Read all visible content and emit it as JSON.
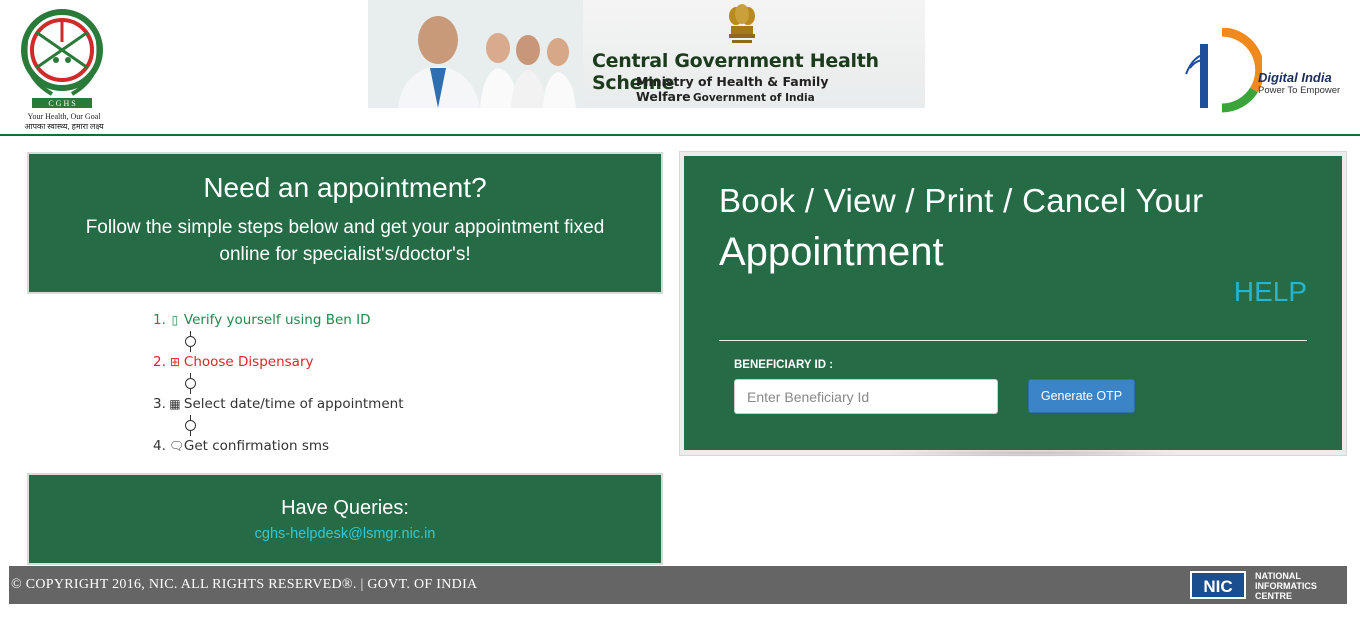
{
  "header": {
    "cghs_caption_line1": "Your Health, Our Goal",
    "cghs_caption_line2": "आपका स्वास्थ्य, हमारा लक्ष्य",
    "banner_title": "Central Government Health Scheme",
    "banner_ministry": "Ministry of Health & Family Welfare",
    "banner_gov": "Government of India",
    "digital_india_title": "Digital India",
    "digital_india_tagline": "Power To Empower"
  },
  "appointment_info": {
    "heading": "Need an appointment?",
    "subtext": "Follow the simple steps below and get your appointment fixed online for specialist's/doctor's!"
  },
  "steps": [
    {
      "num": "1.",
      "icon": "mobile-icon",
      "label": "Verify yourself using Ben ID"
    },
    {
      "num": "2.",
      "icon": "hospital-icon",
      "label": "Choose Dispensary"
    },
    {
      "num": "3.",
      "icon": "calendar-icon",
      "label": "Select date/time of appointment"
    },
    {
      "num": "4.",
      "icon": "comments-icon",
      "label": "Get confirmation sms"
    }
  ],
  "queries": {
    "heading": "Have Queries:",
    "email": "cghs-helpdesk@lsmgr.nic.in"
  },
  "booking": {
    "title_line1": "Book / View / Print / Cancel Your",
    "title_line2": "Appointment",
    "help_link": "HELP",
    "beneficiary_label": "BENEFICIARY ID :",
    "beneficiary_placeholder": "Enter Beneficiary Id",
    "beneficiary_value": "",
    "generate_otp_label": "Generate OTP"
  },
  "footer": {
    "copyright": "© COPYRIGHT 2016, NIC. ALL RIGHTS RESERVED®. | GOVT. OF INDIA",
    "nic_line1": "NATIONAL",
    "nic_line2": "INFORMATICS",
    "nic_line3": "CENTRE"
  },
  "colors": {
    "panel_green": "#256b45",
    "header_rule": "#1d6b2f",
    "help_cyan": "#23b5d3",
    "step_green": "#1f8a4c",
    "step_red": "#e0242c",
    "button_blue": "#3c84c8",
    "footer_gray": "#656565"
  }
}
